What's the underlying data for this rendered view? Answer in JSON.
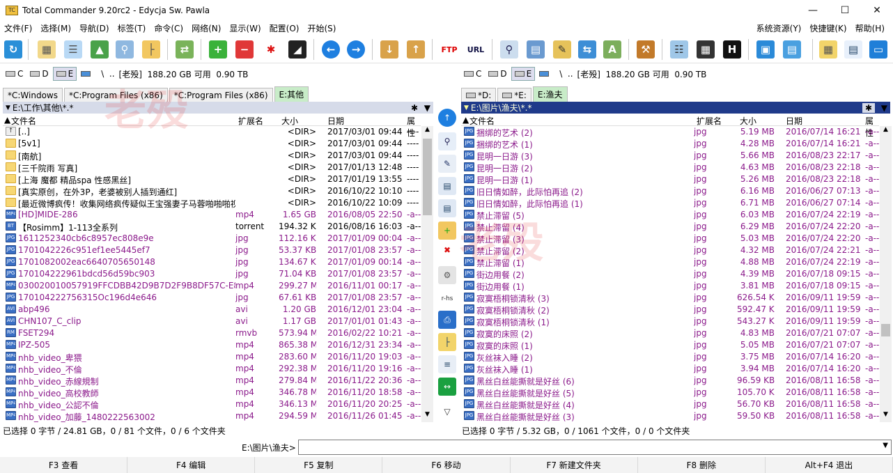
{
  "window": {
    "title": "Total Commander 9.20rc2 - Edycja Sw. Pawla"
  },
  "menu": [
    "文件(F)",
    "选择(M)",
    "导航(D)",
    "标签(T)",
    "命令(C)",
    "网络(N)",
    "显示(W)",
    "配置(O)",
    "开始(S)"
  ],
  "menu_right": [
    "系统资源(Y)",
    "快捷键(K)",
    "帮助(H)"
  ],
  "toolbar_icons": [
    "refresh-icon",
    "brief-view-icon",
    "full-view-icon",
    "thumbnail-view-icon",
    "quick-view-icon",
    "tree-icon",
    "sync-dirs-icon",
    "select-group-icon",
    "unselect-group-icon",
    "invert-selection-icon",
    "compare-icon",
    "back-icon",
    "forward-icon",
    "pack-icon",
    "unpack-icon",
    "ftp-icon",
    "url-icon",
    "search-icon",
    "copy-names-icon",
    "multi-rename-icon",
    "sync-icon",
    "move-icon",
    "settings-icon",
    "notepad-icon",
    "calculator-icon",
    "hex-icon",
    "desktop-icon",
    "computer-icon",
    "button-bar-icon",
    "panel-icon",
    "window-icon"
  ],
  "watermark": "老殁",
  "left": {
    "drives": [
      "c",
      "d",
      "e"
    ],
    "drive_info_prefix": "\\  ..",
    "drive_info": "[老殁]  188.20 GB 可用  0.90 TB",
    "tabs": [
      "*C:Windows",
      "*C:Program Files (x86)",
      "*C:Program Files (x86)",
      "E:其他"
    ],
    "path": "E:\\工作\\其他\\*.*",
    "headers": {
      "name": "文件名",
      "ext": "扩展名",
      "size": "大小",
      "date": "日期",
      "attr": "属性"
    },
    "files": [
      {
        "t": "up",
        "name": "[..]",
        "ext": "",
        "size": "<DIR>",
        "date": "2017/03/01 09:44",
        "attr": "----"
      },
      {
        "t": "folder",
        "name": "[5v1]",
        "ext": "",
        "size": "<DIR>",
        "date": "2017/03/01 09:44",
        "attr": "----"
      },
      {
        "t": "folder",
        "name": "[南航]",
        "ext": "",
        "size": "<DIR>",
        "date": "2017/03/01 09:44",
        "attr": "----"
      },
      {
        "t": "folder",
        "name": "[三千院雨 写真]",
        "ext": "",
        "size": "<DIR>",
        "date": "2017/01/13 12:48",
        "attr": "----"
      },
      {
        "t": "folder",
        "name": "[上海 魔都 精品spa 性感黑丝]",
        "ext": "",
        "size": "<DIR>",
        "date": "2017/01/19 13:55",
        "attr": "----"
      },
      {
        "t": "folder",
        "name": "[真实原创，在外3P，老婆被别人插到通红]",
        "ext": "",
        "size": "<DIR>",
        "date": "2016/10/22 10:10",
        "attr": "----"
      },
      {
        "t": "folder",
        "name": "[最近微博疯传！收集网络疯传疑似王宝强妻子马蓉啪啪啪视频4部包..]",
        "ext": "",
        "size": "<DIR>",
        "date": "2016/10/22 10:09",
        "attr": "----"
      },
      {
        "t": "file",
        "name": "[HD]MIDE-286",
        "ext": "mp4",
        "size": "1.65 GB",
        "date": "2016/08/05 22:50",
        "attr": "-a--",
        "c": "m",
        "ico": "MP4"
      },
      {
        "t": "file",
        "name": "【Rosimm】1-113全系列",
        "ext": "torrent",
        "size": "194.32 KB",
        "date": "2016/08/16 16:03",
        "attr": "-a--",
        "c": "k",
        "ico": "BT"
      },
      {
        "t": "file",
        "name": "1611252340cb6c8957ec808e9e",
        "ext": "jpg",
        "size": "112.16 KB",
        "date": "2017/01/09 00:04",
        "attr": "-a--",
        "c": "m",
        "ico": "JPG"
      },
      {
        "t": "file",
        "name": "1701042226c951ef1ee5445ef7",
        "ext": "jpg",
        "size": "53.37 KB",
        "date": "2017/01/08 23:57",
        "attr": "-a--",
        "c": "m",
        "ico": "JPG"
      },
      {
        "t": "file",
        "name": "1701082002eac6640705650148",
        "ext": "jpg",
        "size": "134.67 KB",
        "date": "2017/01/09 00:14",
        "attr": "-a--",
        "c": "m",
        "ico": "JPG"
      },
      {
        "t": "file",
        "name": "170104222961bdcd56d59bc903",
        "ext": "jpg",
        "size": "71.04 KB",
        "date": "2017/01/08 23:57",
        "attr": "-a--",
        "c": "m",
        "ico": "JPG"
      },
      {
        "t": "file",
        "name": "030020010057919FFCDBB42D9B7D2F9B8DF57C-E835-..",
        "ext": "mp4",
        "size": "299.27 MB",
        "date": "2016/11/01 00:17",
        "attr": "-a--",
        "c": "m",
        "ico": "MP4"
      },
      {
        "t": "file",
        "name": "170104222756315Oc196d4e646",
        "ext": "jpg",
        "size": "67.61 KB",
        "date": "2017/01/08 23:57",
        "attr": "-a--",
        "c": "m",
        "ico": "JPG"
      },
      {
        "t": "file",
        "name": "abp496",
        "ext": "avi",
        "size": "1.20 GB",
        "date": "2016/12/01 23:04",
        "attr": "-a--",
        "c": "m",
        "ico": "AVI"
      },
      {
        "t": "file",
        "name": "CHN107_C_clip",
        "ext": "avi",
        "size": "1.17 GB",
        "date": "2017/01/01 01:43",
        "attr": "-a--",
        "c": "m",
        "ico": "AVI"
      },
      {
        "t": "file",
        "name": "FSET294",
        "ext": "rmvb",
        "size": "573.94 MB",
        "date": "2016/02/22 10:21",
        "attr": "-a--",
        "c": "m",
        "ico": "RM"
      },
      {
        "t": "file",
        "name": "IPZ-505",
        "ext": "mp4",
        "size": "865.38 MB",
        "date": "2016/12/31 23:34",
        "attr": "-a--",
        "c": "m",
        "ico": "MP4"
      },
      {
        "t": "file",
        "name": "nhb_video_卑猥",
        "ext": "mp4",
        "size": "283.60 MB",
        "date": "2016/11/20 19:03",
        "attr": "-a--",
        "c": "m",
        "ico": "MP4"
      },
      {
        "t": "file",
        "name": "nhb_video_不倫",
        "ext": "mp4",
        "size": "292.38 MB",
        "date": "2016/11/20 19:16",
        "attr": "-a--",
        "c": "m",
        "ico": "MP4"
      },
      {
        "t": "file",
        "name": "nhb_video_赤線規制",
        "ext": "mp4",
        "size": "279.84 MB",
        "date": "2016/11/22 20:36",
        "attr": "-a--",
        "c": "m",
        "ico": "MP4"
      },
      {
        "t": "file",
        "name": "nhb_video_高校教師",
        "ext": "mp4",
        "size": "346.78 MB",
        "date": "2016/11/20 18:58",
        "attr": "-a--",
        "c": "m",
        "ico": "MP4"
      },
      {
        "t": "file",
        "name": "nhb_video_公認不倫",
        "ext": "mp4",
        "size": "346.13 MB",
        "date": "2016/11/20 20:25",
        "attr": "-a--",
        "c": "m",
        "ico": "MP4"
      },
      {
        "t": "file",
        "name": "nhb_video_加藤_1480222563002",
        "ext": "mp4",
        "size": "294.59 MB",
        "date": "2016/11/26 01:45",
        "attr": "-a--",
        "c": "m",
        "ico": "MP4"
      }
    ],
    "status": "已选择 0 字节 / 24.81 GB，0 / 81 个文件，0 / 6 个文件夹"
  },
  "right": {
    "drives": [
      "c",
      "d",
      "e"
    ],
    "drive_info_prefix": "\\  ..",
    "drive_info": "[老殁]  188.20 GB 可用  0.90 TB",
    "tabs": [
      "*D:",
      "*E:",
      "E:渔夫"
    ],
    "path": "E:\\图片\\渔夫\\*.*",
    "headers": {
      "name": "文件名",
      "ext": "扩展名",
      "size": "大小",
      "date": "日期",
      "attr": "属性"
    },
    "files": [
      {
        "name": "捆绑的艺术 (2)",
        "ext": "jpg",
        "size": "5.19 MB",
        "date": "2016/07/14 16:21",
        "attr": "-a--"
      },
      {
        "name": "捆绑的艺术 (1)",
        "ext": "jpg",
        "size": "4.28 MB",
        "date": "2016/07/14 16:21",
        "attr": "-a--"
      },
      {
        "name": "昆明一日游 (3)",
        "ext": "jpg",
        "size": "5.66 MB",
        "date": "2016/08/23 22:17",
        "attr": "-a--"
      },
      {
        "name": "昆明一日游 (2)",
        "ext": "jpg",
        "size": "4.63 MB",
        "date": "2016/08/23 22:18",
        "attr": "-a--"
      },
      {
        "name": "昆明一日游 (1)",
        "ext": "jpg",
        "size": "5.26 MB",
        "date": "2016/08/23 22:18",
        "attr": "-a--"
      },
      {
        "name": "旧日情如醉，此际怕再追 (2)",
        "ext": "jpg",
        "size": "6.16 MB",
        "date": "2016/06/27 07:13",
        "attr": "-a--"
      },
      {
        "name": "旧日情如醉，此际怕再追 (1)",
        "ext": "jpg",
        "size": "6.71 MB",
        "date": "2016/06/27 07:14",
        "attr": "-a--"
      },
      {
        "name": "禁止滞留 (5)",
        "ext": "jpg",
        "size": "6.03 MB",
        "date": "2016/07/24 22:19",
        "attr": "-a--"
      },
      {
        "name": "禁止滞留 (4)",
        "ext": "jpg",
        "size": "6.29 MB",
        "date": "2016/07/24 22:20",
        "attr": "-a--"
      },
      {
        "name": "禁止滞留 (3)",
        "ext": "jpg",
        "size": "5.03 MB",
        "date": "2016/07/24 22:20",
        "attr": "-a--"
      },
      {
        "name": "禁止滞留 (2)",
        "ext": "jpg",
        "size": "4.32 MB",
        "date": "2016/07/24 22:21",
        "attr": "-a--"
      },
      {
        "name": "禁止滞留 (1)",
        "ext": "jpg",
        "size": "4.88 MB",
        "date": "2016/07/24 22:19",
        "attr": "-a--"
      },
      {
        "name": "街边用餐 (2)",
        "ext": "jpg",
        "size": "4.39 MB",
        "date": "2016/07/18 09:15",
        "attr": "-a--"
      },
      {
        "name": "街边用餐 (1)",
        "ext": "jpg",
        "size": "3.81 MB",
        "date": "2016/07/18 09:15",
        "attr": "-a--"
      },
      {
        "name": "寂寞梧桐锁清秋 (3)",
        "ext": "jpg",
        "size": "626.54 KB",
        "date": "2016/09/11 19:59",
        "attr": "-a--"
      },
      {
        "name": "寂寞梧桐锁清秋 (2)",
        "ext": "jpg",
        "size": "592.47 KB",
        "date": "2016/09/11 19:59",
        "attr": "-a--"
      },
      {
        "name": "寂寞梧桐锁清秋 (1)",
        "ext": "jpg",
        "size": "543.27 KB",
        "date": "2016/09/11 19:59",
        "attr": "-a--"
      },
      {
        "name": "寂寞的床照 (2)",
        "ext": "jpg",
        "size": "4.83 MB",
        "date": "2016/07/21 07:07",
        "attr": "-a--"
      },
      {
        "name": "寂寞的床照 (1)",
        "ext": "jpg",
        "size": "5.05 MB",
        "date": "2016/07/21 07:07",
        "attr": "-a--"
      },
      {
        "name": "灰丝袜入睡 (2)",
        "ext": "jpg",
        "size": "3.75 MB",
        "date": "2016/07/14 16:20",
        "attr": "-a--"
      },
      {
        "name": "灰丝袜入睡 (1)",
        "ext": "jpg",
        "size": "3.94 MB",
        "date": "2016/07/14 16:20",
        "attr": "-a--"
      },
      {
        "name": "黑丝白丝能撕就是好丝 (6)",
        "ext": "jpg",
        "size": "96.59 KB",
        "date": "2016/08/11 16:58",
        "attr": "-a--"
      },
      {
        "name": "黑丝白丝能撕就是好丝 (5)",
        "ext": "jpg",
        "size": "105.70 KB",
        "date": "2016/08/11 16:58",
        "attr": "-a--"
      },
      {
        "name": "黑丝白丝能撕就是好丝 (4)",
        "ext": "jpg",
        "size": "56.70 KB",
        "date": "2016/08/11 16:58",
        "attr": "-a--"
      },
      {
        "name": "黑丝白丝能撕就是好丝 (3)",
        "ext": "jpg",
        "size": "59.50 KB",
        "date": "2016/08/11 16:58",
        "attr": "-a--"
      }
    ],
    "status": "已选择 0 字节 / 5.32 GB，0 / 1061 个文件，0 / 0 个文件夹"
  },
  "cmdline": {
    "prompt": "E:\\图片\\渔夫>"
  },
  "fkeys": [
    "F3 查看",
    "F4 编辑",
    "F5 复制",
    "F6 移动",
    "F7 新建文件夹",
    "F8 删除",
    "Alt+F4 退出"
  ],
  "colors": {
    "file_purple": "#8b1a8b",
    "active_path_bg": "#1f3a8a",
    "inactive_path_bg": "#d6dbe9"
  }
}
